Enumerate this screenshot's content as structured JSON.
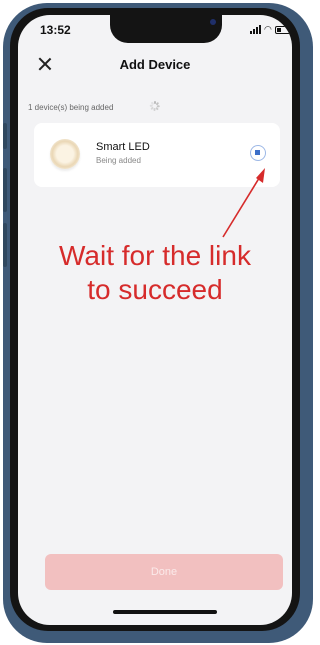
{
  "status_bar": {
    "time": "13:52"
  },
  "header": {
    "title": "Add Device",
    "close_icon": "close-icon"
  },
  "progress": {
    "label": "1 device(s) being added"
  },
  "device": {
    "name": "Smart LED",
    "status": "Being added",
    "icon": "bulb-icon",
    "action_icon": "stop-icon"
  },
  "annotation": {
    "line1": "Wait for the link",
    "line2": "to succeed",
    "color": "#d62b2b"
  },
  "footer": {
    "done_label": "Done"
  },
  "colors": {
    "accent": "#3c6fc9",
    "done_disabled": "#f2c0c0",
    "frame": "#3f5a78"
  }
}
